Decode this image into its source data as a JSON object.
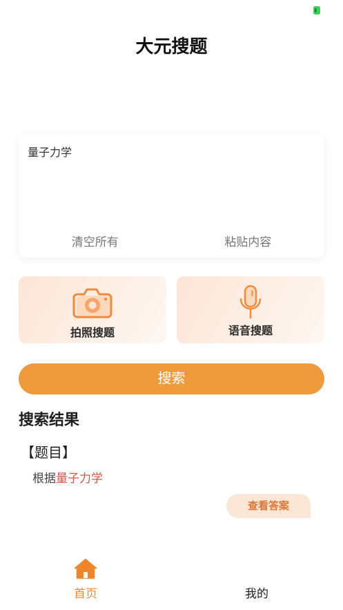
{
  "status_bar": {
    "battery_icon": "battery-icon"
  },
  "app": {
    "title": "大元搜题"
  },
  "search_box": {
    "value": "量子力学",
    "clear_label": "清空所有",
    "paste_label": "粘贴内容"
  },
  "quick_actions": [
    {
      "label": "拍照搜题",
      "icon": "camera-icon"
    },
    {
      "label": "语音搜题",
      "icon": "microphone-icon"
    }
  ],
  "search_button": {
    "label": "搜索"
  },
  "results": {
    "heading": "搜索结果",
    "items": [
      {
        "tag": "【题目】",
        "prefix": "根据",
        "highlight": "量子力学",
        "answer_label": "查看答案"
      }
    ]
  },
  "tab_bar": {
    "items": [
      {
        "label": "首页",
        "icon": "home-icon",
        "active": true
      },
      {
        "label": "我的",
        "active": false
      }
    ]
  },
  "colors": {
    "accent": "#EE9B3D",
    "tab_active": "#E98B3C",
    "highlight_text": "#C9584A",
    "icon_orange": "#F08A3C",
    "pill_bg": "#FCE6D6",
    "pill_text": "#D9783A",
    "battery": "#3FCF5A",
    "text_primary": "#222222",
    "text_muted": "#777777"
  }
}
